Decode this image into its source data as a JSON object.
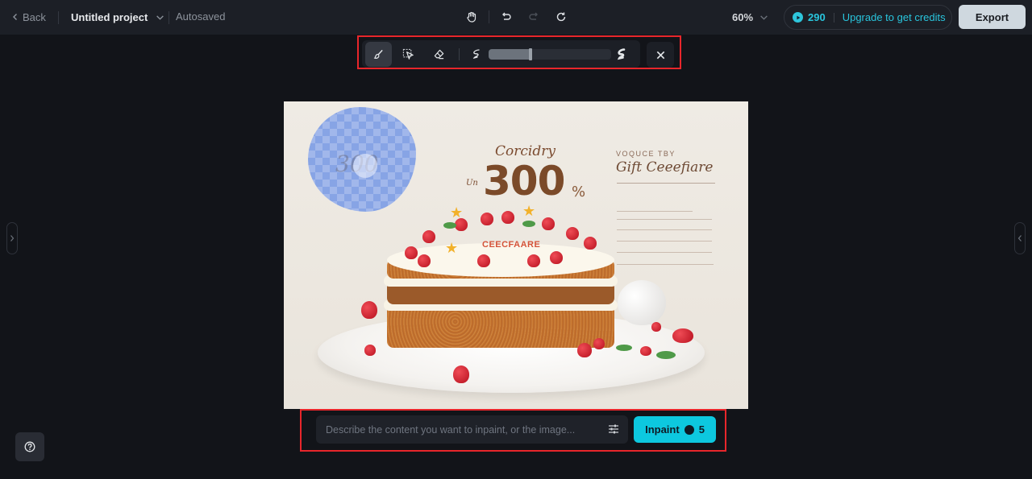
{
  "topbar": {
    "back_label": "Back",
    "project_title": "Untitled project",
    "save_status": "Autosaved",
    "zoom_level": "60%",
    "credits_count": "290",
    "upgrade_label": "Upgrade to get credits",
    "export_label": "Export",
    "center_tools": [
      "hand-icon",
      "undo-icon",
      "redo-icon",
      "refresh-icon"
    ]
  },
  "brush_toolbar": {
    "tools": [
      {
        "name": "brush",
        "active": true
      },
      {
        "name": "smart-select",
        "active": false
      },
      {
        "name": "eraser",
        "active": false
      }
    ],
    "brush_size_fraction": 0.34,
    "close_label": "Close"
  },
  "canvas": {
    "image_texts": {
      "subtitle": "Corcidry",
      "prefix": "Un",
      "number": "300",
      "percent": "%",
      "cert_top": "VOQUCE TBY",
      "cert_title": "Gift Ceeefiare",
      "cake_label": "CEECFAARE"
    }
  },
  "prompt": {
    "placeholder": "Describe the content you want to inpaint, or the image...",
    "value": "",
    "inpaint_label": "Inpaint",
    "inpaint_cost": "5"
  },
  "colors": {
    "accent": "#0dc8df",
    "credit_text": "#29c5dd",
    "highlight_frame": "#e8262b",
    "background": "#121419",
    "topbar": "#1c1f26"
  }
}
